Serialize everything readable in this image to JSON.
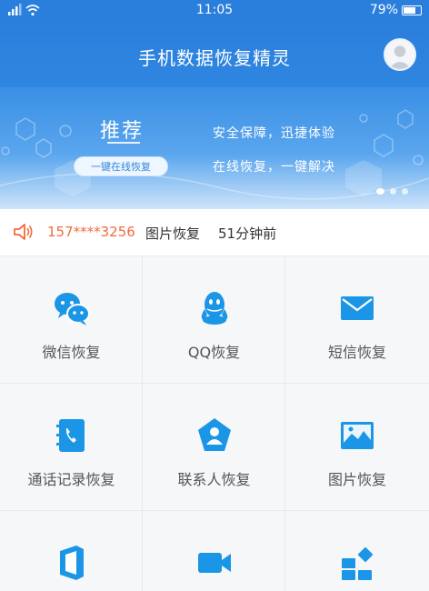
{
  "status_bar": {
    "time": "11:05",
    "battery": "79%",
    "battery_level": 0.79
  },
  "header": {
    "title": "手机数据恢复精灵",
    "avatar_icon": "user-avatar-icon"
  },
  "banner": {
    "heading": "推荐",
    "button_label": "一键在线恢复",
    "line1": "安全保障，迅捷体验",
    "line2": "在线恢复，一键解决"
  },
  "notice": {
    "phone": "157****3256",
    "type": "图片恢复",
    "time": "51分钟前"
  },
  "grid": {
    "items": [
      {
        "label": "微信恢复",
        "icon": "wechat-icon"
      },
      {
        "label": "QQ恢复",
        "icon": "qq-icon"
      },
      {
        "label": "短信恢复",
        "icon": "envelope-icon"
      },
      {
        "label": "通话记录恢复",
        "icon": "call-log-icon"
      },
      {
        "label": "联系人恢复",
        "icon": "contact-icon"
      },
      {
        "label": "图片恢复",
        "icon": "picture-icon"
      },
      {
        "label": "",
        "icon": "office-icon"
      },
      {
        "label": "",
        "icon": "video-camera-icon"
      },
      {
        "label": "",
        "icon": "apps-icon"
      }
    ]
  },
  "colors": {
    "accent": "#2a7fdc",
    "icon_blue": "#1b96e6",
    "notice_red": "#f26b3a"
  }
}
